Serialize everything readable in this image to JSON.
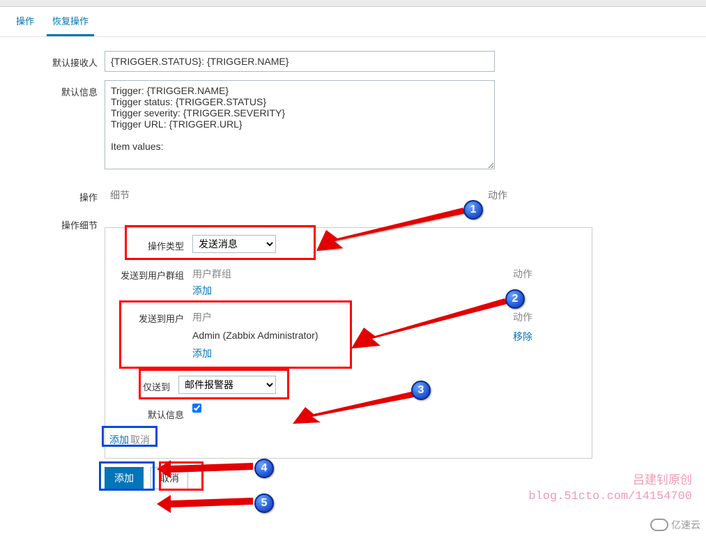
{
  "tabs": {
    "operation": "操作",
    "recovery": "恢复操作"
  },
  "labels": {
    "defaultRecipient": "默认接收人",
    "defaultInfo": "默认信息",
    "operation": "操作",
    "operationDetail": "操作细节"
  },
  "fields": {
    "subject": "{TRIGGER.STATUS}: {TRIGGER.NAME}",
    "message": "Trigger: {TRIGGER.NAME}\nTrigger status: {TRIGGER.STATUS}\nTrigger severity: {TRIGGER.SEVERITY}\nTrigger URL: {TRIGGER.URL}\n\nItem values:\n"
  },
  "opsHeader": {
    "detail": "细节",
    "action": "动作"
  },
  "detail": {
    "opTypeLabel": "操作类型",
    "opTypeValue": "发送消息",
    "sendToGroupLabel": "发送到用户群组",
    "groupHead": "用户群组",
    "actionHead": "动作",
    "addLink": "添加",
    "sendToUserLabel": "发送到用户",
    "userHead": "用户",
    "userValue": "Admin (Zabbix Administrator)",
    "removeLink": "移除",
    "onlySendLabel": "仅送到",
    "onlySendValue": "邮件报警器",
    "defaultMsgLabel": "默认信息",
    "addAction": "添加",
    "cancelAction": "取消"
  },
  "buttons": {
    "add": "添加",
    "cancel": "取消"
  },
  "badges": {
    "n1": "1",
    "n2": "2",
    "n3": "3",
    "n4": "4",
    "n5": "5"
  },
  "watermark": {
    "line1": "吕建钊原创",
    "line2": "blog.51cto.com/14154700"
  },
  "brand": "亿速云"
}
